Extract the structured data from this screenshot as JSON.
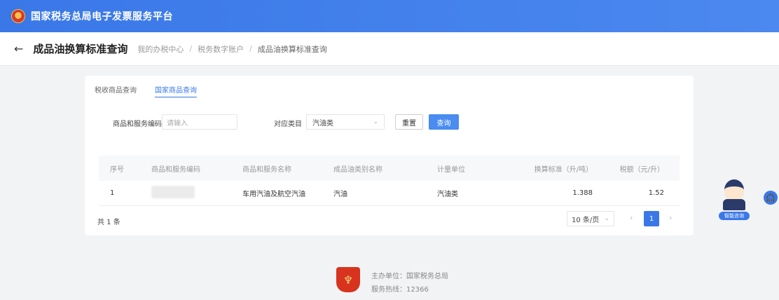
{
  "app": {
    "title": "国家税务总局电子发票服务平台"
  },
  "header": {
    "title": "成品油换算标准查询",
    "breadcrumbs": [
      "我的办税中心",
      "税务数字账户",
      "成品油换算标准查询"
    ]
  },
  "tabs": [
    {
      "label": "税收商品查询",
      "active": false
    },
    {
      "label": "国家商品查询",
      "active": true
    }
  ],
  "filters": {
    "code_label": "商品和服务编码",
    "code_placeholder": "请输入",
    "category_label": "对应类目",
    "category_value": "汽油类",
    "reset_label": "重置",
    "query_label": "查询"
  },
  "table": {
    "columns": [
      "序号",
      "商品和服务编码",
      "商品和服务名称",
      "成品油类别名称",
      "计量单位",
      "换算标准（升/吨）",
      "税额（元/升）"
    ],
    "rows": [
      {
        "index": "1",
        "code": "",
        "name": "车用汽油及航空汽油",
        "category": "汽油",
        "unit": "汽油类",
        "standard": "1.388",
        "rate": "1.52"
      }
    ]
  },
  "pagination": {
    "total": "共 1 条",
    "page_size": "10 条/页",
    "prev": "‹",
    "current": "1",
    "next": "›"
  },
  "assistant": {
    "label": "智能咨询"
  },
  "footer": {
    "line1": "主办单位：国家税务总局",
    "line2": "服务热线：12366"
  }
}
